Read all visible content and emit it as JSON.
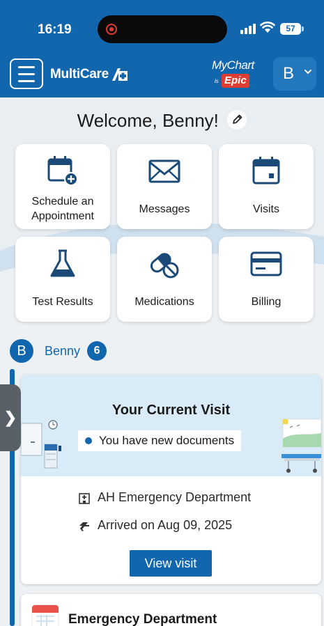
{
  "status_bar": {
    "time": "16:19",
    "battery": "57"
  },
  "header": {
    "brand": "MultiCare",
    "mychart_top": "MyChart",
    "mychart_is": "is",
    "mychart_epic": "Epic",
    "profile_initial": "B"
  },
  "welcome": {
    "title": "Welcome, Benny!"
  },
  "tiles": [
    {
      "label_line1": "Schedule an",
      "label_line2": "Appointment",
      "icon": "calendar-plus-icon"
    },
    {
      "label": "Messages",
      "icon": "envelope-icon"
    },
    {
      "label": "Visits",
      "icon": "calendar-icon"
    },
    {
      "label": "Test Results",
      "icon": "flask-icon"
    },
    {
      "label": "Medications",
      "icon": "pills-icon"
    },
    {
      "label": "Billing",
      "icon": "credit-card-icon"
    }
  ],
  "patient": {
    "initial": "B",
    "name": "Benny",
    "count": "6"
  },
  "current_visit": {
    "title": "Your Current Visit",
    "notice": "You have new documents",
    "department": "AH Emergency Department",
    "arrived": "Arrived on Aug 09, 2025",
    "button": "View visit"
  },
  "next_card": {
    "title": "Emergency Department"
  },
  "side_handle": {
    "glyph": "❯"
  },
  "colors": {
    "brand_blue": "#1266ad",
    "epic_red": "#e03c31"
  }
}
